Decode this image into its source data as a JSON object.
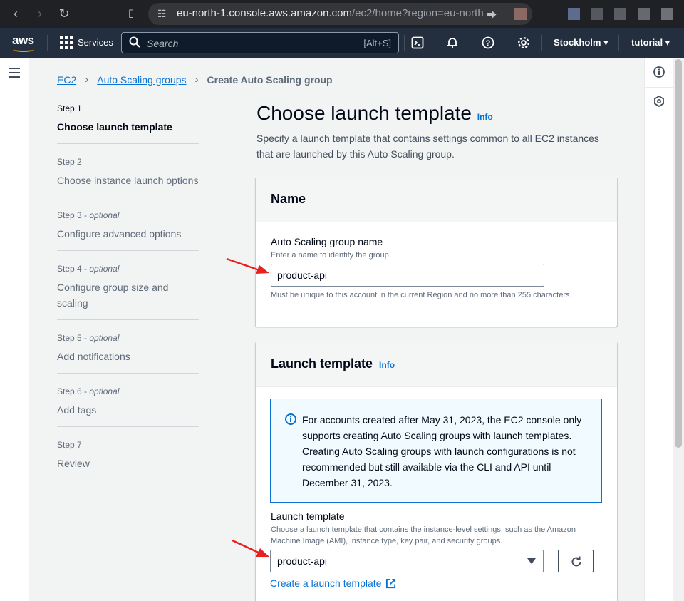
{
  "browser": {
    "url_main": "eu-north-1.console.aws.amazon.com",
    "url_rest": "/ec2/home?region=eu-north-..."
  },
  "aws_nav": {
    "logo": "aws",
    "services_label": "Services",
    "search_placeholder": "Search",
    "search_shortcut": "[Alt+S]",
    "region": "Stockholm",
    "account": "tutorial"
  },
  "breadcrumb": {
    "root": "EC2",
    "parent": "Auto Scaling groups",
    "current": "Create Auto Scaling group"
  },
  "steps": [
    {
      "number": "Step 1",
      "optional": "",
      "title": "Choose launch template"
    },
    {
      "number": "Step 2",
      "optional": "",
      "title": "Choose instance launch options"
    },
    {
      "number": "Step 3",
      "optional": "optional",
      "title": "Configure advanced options"
    },
    {
      "number": "Step 4",
      "optional": "optional",
      "title": "Configure group size and scaling"
    },
    {
      "number": "Step 5",
      "optional": "optional",
      "title": "Add notifications"
    },
    {
      "number": "Step 6",
      "optional": "optional",
      "title": "Add tags"
    },
    {
      "number": "Step 7",
      "optional": "",
      "title": "Review"
    }
  ],
  "page": {
    "title": "Choose launch template",
    "info": "Info",
    "description": "Specify a launch template that contains settings common to all EC2 instances that are launched by this Auto Scaling group."
  },
  "name_panel": {
    "title": "Name",
    "field_label": "Auto Scaling group name",
    "field_desc": "Enter a name to identify the group.",
    "field_value": "product-api",
    "constraint": "Must be unique to this account in the current Region and no more than 255 characters."
  },
  "launch_panel": {
    "title": "Launch template",
    "info": "Info",
    "alert_text": "For accounts created after May 31, 2023, the EC2 console only supports creating Auto Scaling groups with launch templates. Creating Auto Scaling groups with launch configurations is not recommended but still available via the CLI and API until December 31, 2023.",
    "field_label": "Launch template",
    "field_desc": "Choose a launch template that contains the instance-level settings, such as the Amazon Machine Image (AMI), instance type, key pair, and security groups.",
    "selected_value": "product-api",
    "create_link": "Create a launch template"
  },
  "colors": {
    "link": "#0972d3",
    "nav_bg": "#232f3e",
    "arrow": "#e8201f"
  }
}
